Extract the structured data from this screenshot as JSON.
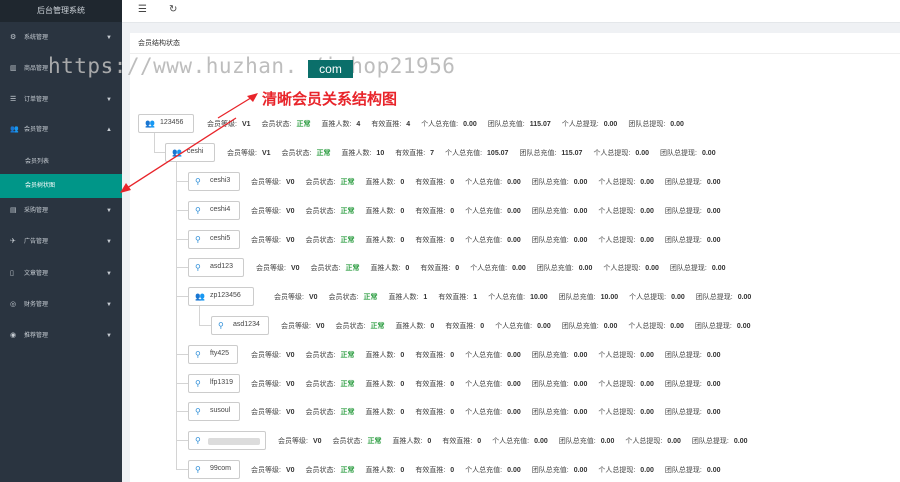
{
  "app": {
    "title": "后台管理系统"
  },
  "sidebar": {
    "items": [
      {
        "label": "系统管理",
        "icon": "gear-icon",
        "glyph": "⚙"
      },
      {
        "label": "商品管理",
        "icon": "chart-icon",
        "glyph": "▥"
      },
      {
        "label": "订单管理",
        "icon": "list-icon",
        "glyph": "☰"
      },
      {
        "label": "会员管理",
        "icon": "users-icon",
        "glyph": "👥",
        "expanded": true,
        "children": [
          {
            "label": "会员列表",
            "active": false
          },
          {
            "label": "会员树状图",
            "active": true
          }
        ]
      },
      {
        "label": "采购管理",
        "icon": "briefcase-icon",
        "glyph": "▤"
      },
      {
        "label": "广告管理",
        "icon": "rocket-icon",
        "glyph": "✈"
      },
      {
        "label": "文章管理",
        "icon": "document-icon",
        "glyph": "▯"
      },
      {
        "label": "财务管理",
        "icon": "globe-icon",
        "glyph": "◎"
      },
      {
        "label": "推荐管理",
        "icon": "target-icon",
        "glyph": "◉"
      }
    ]
  },
  "header": {
    "menu_icon": "☰",
    "refresh_icon": "↻"
  },
  "page": {
    "title": "会员结构状态"
  },
  "watermark": {
    "text": "https://www.huzhan.    /ishop21956",
    "badge": "com",
    "annotation": "清晰会员关系结构图"
  },
  "fields": {
    "level": "会员等级:",
    "status": "会员状态:",
    "direct": "直推人数:",
    "valid": "有效直推:",
    "personal_recharge": "个人总充值:",
    "team_recharge": "团队总充值:",
    "personal_withdraw": "个人总提现:",
    "team_withdraw": "团队总提现:"
  },
  "members": [
    {
      "name": "123456",
      "level": "V1",
      "status": "正常",
      "direct": "4",
      "valid": "4",
      "personal_recharge": "0.00",
      "team_recharge": "115.07",
      "personal_withdraw": "0.00",
      "team_withdraw": "0.00",
      "icon": "group-icon"
    },
    {
      "name": "ceshi",
      "level": "V1",
      "status": "正常",
      "direct": "10",
      "valid": "7",
      "personal_recharge": "105.07",
      "team_recharge": "115.07",
      "personal_withdraw": "0.00",
      "team_withdraw": "0.00",
      "icon": "group-icon"
    },
    {
      "name": "ceshi3",
      "level": "V0",
      "status": "正常",
      "direct": "0",
      "valid": "0",
      "personal_recharge": "0.00",
      "team_recharge": "0.00",
      "personal_withdraw": "0.00",
      "team_withdraw": "0.00",
      "icon": "user-icon"
    },
    {
      "name": "ceshi4",
      "level": "V0",
      "status": "正常",
      "direct": "0",
      "valid": "0",
      "personal_recharge": "0.00",
      "team_recharge": "0.00",
      "personal_withdraw": "0.00",
      "team_withdraw": "0.00",
      "icon": "user-icon"
    },
    {
      "name": "ceshi5",
      "level": "V0",
      "status": "正常",
      "direct": "0",
      "valid": "0",
      "personal_recharge": "0.00",
      "team_recharge": "0.00",
      "personal_withdraw": "0.00",
      "team_withdraw": "0.00",
      "icon": "user-icon"
    },
    {
      "name": "asd123",
      "level": "V0",
      "status": "正常",
      "direct": "0",
      "valid": "0",
      "personal_recharge": "0.00",
      "team_recharge": "0.00",
      "personal_withdraw": "0.00",
      "team_withdraw": "0.00",
      "icon": "user-icon"
    },
    {
      "name": "zp123456",
      "level": "V0",
      "status": "正常",
      "direct": "1",
      "valid": "1",
      "personal_recharge": "10.00",
      "team_recharge": "10.00",
      "personal_withdraw": "0.00",
      "team_withdraw": "0.00",
      "icon": "group-icon"
    },
    {
      "name": "asd1234",
      "level": "V0",
      "status": "正常",
      "direct": "0",
      "valid": "0",
      "personal_recharge": "0.00",
      "team_recharge": "0.00",
      "personal_withdraw": "0.00",
      "team_withdraw": "0.00",
      "icon": "user-icon"
    },
    {
      "name": "fty425",
      "level": "V0",
      "status": "正常",
      "direct": "0",
      "valid": "0",
      "personal_recharge": "0.00",
      "team_recharge": "0.00",
      "personal_withdraw": "0.00",
      "team_withdraw": "0.00",
      "icon": "user-icon"
    },
    {
      "name": "lfp1319",
      "level": "V0",
      "status": "正常",
      "direct": "0",
      "valid": "0",
      "personal_recharge": "0.00",
      "team_recharge": "0.00",
      "personal_withdraw": "0.00",
      "team_withdraw": "0.00",
      "icon": "user-icon"
    },
    {
      "name": "susoul",
      "level": "V0",
      "status": "正常",
      "direct": "0",
      "valid": "0",
      "personal_recharge": "0.00",
      "team_recharge": "0.00",
      "personal_withdraw": "0.00",
      "team_withdraw": "0.00",
      "icon": "user-icon"
    },
    {
      "name": "",
      "level": "V0",
      "status": "正常",
      "direct": "0",
      "valid": "0",
      "personal_recharge": "0.00",
      "team_recharge": "0.00",
      "personal_withdraw": "0.00",
      "team_withdraw": "0.00",
      "icon": "user-icon",
      "redacted": true
    },
    {
      "name": "99com",
      "level": "V0",
      "status": "正常",
      "direct": "0",
      "valid": "0",
      "personal_recharge": "0.00",
      "team_recharge": "0.00",
      "personal_withdraw": "0.00",
      "team_withdraw": "0.00",
      "icon": "user-icon"
    }
  ]
}
